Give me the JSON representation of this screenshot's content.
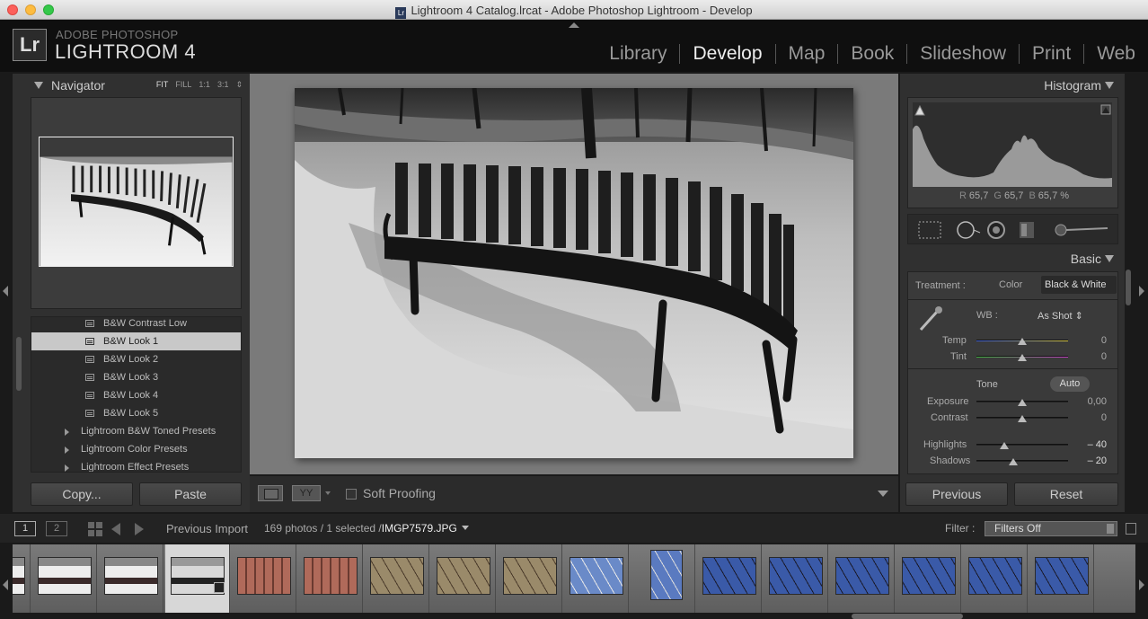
{
  "window": {
    "title": "Lightroom 4 Catalog.lrcat - Adobe Photoshop Lightroom - Develop",
    "app_icon_label": "Lr"
  },
  "brand": {
    "logo": "Lr",
    "top": "ADOBE PHOTOSHOP",
    "main": "LIGHTROOM 4"
  },
  "modules": [
    {
      "label": "Library",
      "active": false
    },
    {
      "label": "Develop",
      "active": true
    },
    {
      "label": "Map",
      "active": false
    },
    {
      "label": "Book",
      "active": false
    },
    {
      "label": "Slideshow",
      "active": false
    },
    {
      "label": "Print",
      "active": false
    },
    {
      "label": "Web",
      "active": false
    }
  ],
  "navigator": {
    "title": "Navigator",
    "zoom": [
      "FIT",
      "FILL",
      "1:1",
      "3:1"
    ],
    "zoom_selected": "FIT"
  },
  "presets": [
    {
      "label": "B&W Contrast Low",
      "type": "preset",
      "selected": false
    },
    {
      "label": "B&W Look 1",
      "type": "preset",
      "selected": true
    },
    {
      "label": "B&W Look 2",
      "type": "preset",
      "selected": false
    },
    {
      "label": "B&W Look 3",
      "type": "preset",
      "selected": false
    },
    {
      "label": "B&W Look 4",
      "type": "preset",
      "selected": false
    },
    {
      "label": "B&W Look 5",
      "type": "preset",
      "selected": false
    },
    {
      "label": "Lightroom B&W Toned Presets",
      "type": "folder",
      "selected": false
    },
    {
      "label": "Lightroom Color Presets",
      "type": "folder",
      "selected": false
    },
    {
      "label": "Lightroom Effect Presets",
      "type": "folder",
      "selected": false
    }
  ],
  "left_buttons": {
    "copy": "Copy...",
    "paste": "Paste"
  },
  "toolbar": {
    "yy": "YY",
    "soft_proofing": "Soft Proofing",
    "soft_proofing_checked": false
  },
  "histogram": {
    "title": "Histogram",
    "r_label": "R",
    "r": "65,7",
    "g_label": "G",
    "g": "65,7",
    "b_label": "B",
    "b": "65,7",
    "unit": "%"
  },
  "basic": {
    "title": "Basic",
    "treatment_label": "Treatment :",
    "treatment_color": "Color",
    "treatment_bw": "Black & White",
    "treatment_selected": "Black & White",
    "wb_label": "WB :",
    "wb_value": "As Shot",
    "temp_label": "Temp",
    "temp_value": "0",
    "temp_pos": 0.5,
    "tint_label": "Tint",
    "tint_value": "0",
    "tint_pos": 0.5,
    "tone_label": "Tone",
    "auto_label": "Auto",
    "exposure_label": "Exposure",
    "exposure_value": "0,00",
    "exposure_pos": 0.5,
    "contrast_label": "Contrast",
    "contrast_value": "0",
    "contrast_pos": 0.5,
    "highlights_label": "Highlights",
    "highlights_value": "– 40",
    "highlights_pos": 0.3,
    "shadows_label": "Shadows",
    "shadows_value": "– 20",
    "shadows_pos": 0.4
  },
  "right_buttons": {
    "previous": "Previous",
    "reset": "Reset"
  },
  "filmstrip_bar": {
    "screen1": "1",
    "screen2": "2",
    "source": "Previous Import",
    "count": "169 photos / 1 selected /",
    "filename": "IMGP7579.JPG",
    "filter_label": "Filter :",
    "filter_value": "Filters Off"
  },
  "filmstrip": {
    "selected_index": 3,
    "thumbnails": [
      "bench-snow",
      "bench-snow",
      "bench-snow",
      "bench-bw",
      "red-wall",
      "red-wall",
      "branches-brown",
      "branches-brown",
      "branches-brown",
      "birch-sky",
      "birch-sky-portrait",
      "branches-blue",
      "branches-blue",
      "branches-blue",
      "branches-blue",
      "branches-blue",
      "branches-blue"
    ]
  },
  "colors": {
    "accent": "#dddddd",
    "panel": "#303030",
    "center": "#7a7a7a"
  }
}
